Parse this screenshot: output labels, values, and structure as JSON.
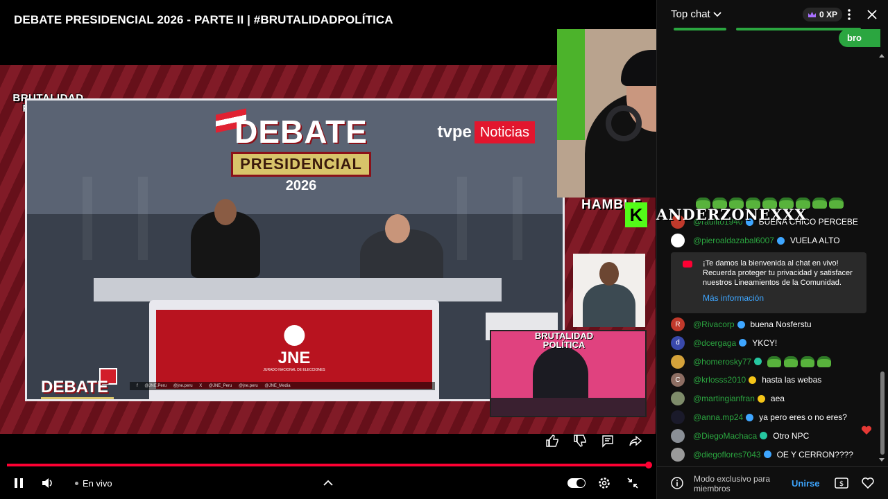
{
  "video": {
    "title": "DEBATE PRESIDENCIAL 2026 - PARTE II | #BRUTALIDADPOLÍTICA",
    "brand_logo_line1": "BRUTALIDAD",
    "brand_logo_line2": "POLÍTICA",
    "broadcast": {
      "logo_debate": "DEBATE",
      "logo_presidencial": "PRESIDENCIAL",
      "logo_year": "2026",
      "tv_logo_left": "tvpe",
      "tv_logo_right": "Noticias",
      "jne_word": "JNE",
      "jne_subtitle": "JURADO NACIONAL DE ELECCIONES",
      "social_strip": "f @JNE.Peru   @jne.peru   X @JNE_Peru   @jne.peru   @JNE_Media"
    },
    "cam_banner_line1": "BRUTALIDAD",
    "cam_banner_line2": "POLÍTICA",
    "overlay_partial_word": "HAMBLE",
    "overlay_k_badge": "K",
    "overlay_username": "ANDERZONEXXX",
    "overlay_emote_count": 9
  },
  "player": {
    "live_label": "En vivo",
    "progress_fraction": 1.0,
    "icons": [
      "pause-icon",
      "volume-icon",
      "chevron-up-icon",
      "autoplay-toggle",
      "settings-icon",
      "exit-fullscreen-icon"
    ],
    "actions": [
      "like-icon",
      "dislike-icon",
      "comment-icon",
      "share-icon"
    ]
  },
  "chat": {
    "mode_label": "Top chat",
    "xp_label": "0 XP",
    "member_pill_label": "bro",
    "messages_top": [
      {
        "author": "@pieroaldazabal6007",
        "text": "VUELA ALTO",
        "avatar_color": "#ffffff",
        "avatar_letter": "",
        "badge": "blue"
      }
    ],
    "partial_message": {
      "author": "@raulito1940",
      "text": "BUENA CHICO PERCEBE"
    },
    "welcome": {
      "text": "¡Te damos la bienvenida al chat en vivo! Recuerda proteger tu privacidad y satisfacer nuestros Lineamientos de la Comunidad.",
      "link": "Más información"
    },
    "messages": [
      {
        "author": "@Rivacorp",
        "text": "buena Nosferstu",
        "avatar_color": "#c0392b",
        "avatar_letter": "R",
        "badge": "blue"
      },
      {
        "author": "@dcergaga",
        "text": "YKCY!",
        "avatar_color": "#3949ab",
        "avatar_letter": "d",
        "badge": "blue"
      },
      {
        "author": "@homerosky77",
        "text": "",
        "avatar_color": "#d4a23a",
        "avatar_letter": "",
        "badge": "teal",
        "emotes": 4
      },
      {
        "author": "@krlosss2010",
        "text": "hasta las webas",
        "avatar_color": "#8d6e63",
        "avatar_letter": "C",
        "badge": "gold"
      },
      {
        "author": "@martingianfran",
        "text": "aea",
        "avatar_color": "#7e8c6a",
        "avatar_letter": "",
        "badge": "gold"
      },
      {
        "author": "@anna.mp24",
        "text": "ya pero eres o no eres?",
        "avatar_color": "#1a1a2a",
        "avatar_letter": "",
        "badge": "blue"
      },
      {
        "author": "@DiegoMachaca",
        "text": "Otro NPC",
        "avatar_color": "#8a8f96",
        "avatar_letter": "",
        "badge": "teal"
      },
      {
        "author": "@diegoflores7043",
        "text": "OE Y CERRON????",
        "avatar_color": "#9a9a9a",
        "avatar_letter": "",
        "badge": "blue"
      }
    ],
    "footer": {
      "members_text": "Modo exclusivo para miembros",
      "join_label": "Unirse"
    },
    "colors": {
      "author": "#2ba640",
      "link": "#3ea6ff",
      "accent": "#ff0033"
    }
  }
}
